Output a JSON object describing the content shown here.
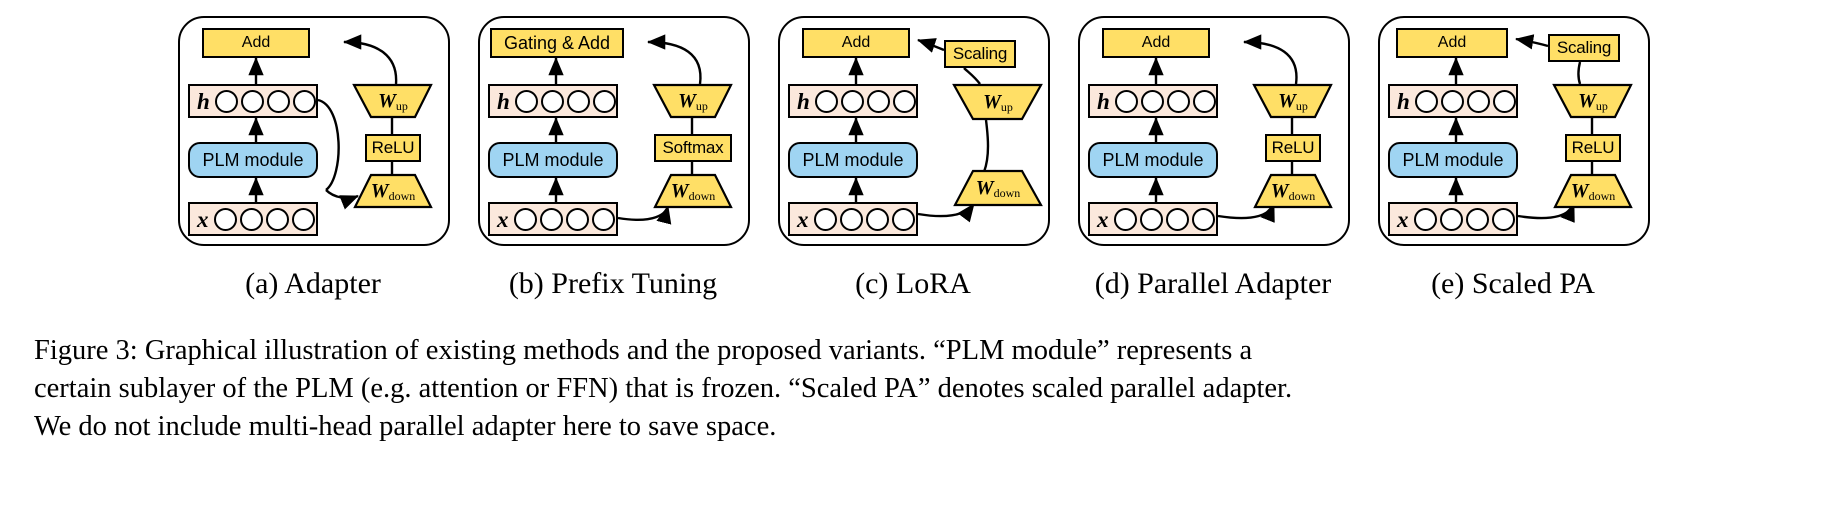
{
  "figure": {
    "number_label": "Figure 3:",
    "caption_line1": "Figure 3:  Graphical illustration of existing methods and the proposed variants.  “PLM module” represents a",
    "caption_line2": "certain sublayer of the PLM (e.g. attention or FFN) that is frozen. “Scaled PA” denotes scaled parallel adapter.",
    "caption_line3": "We do not include multi-head parallel adapter here to save space."
  },
  "colors": {
    "yellow": "#ffdf66",
    "blue": "#9fd4f2",
    "peach": "#fbe8dc",
    "outline": "#000000",
    "background": "#ffffff"
  },
  "common": {
    "plm_module": "PLM module",
    "h_label": "h",
    "x_label": "x",
    "w_up": "W",
    "w_up_sub": "up",
    "w_down": "W",
    "w_down_sub": "down",
    "neuron_count": 4
  },
  "panels": [
    {
      "id": "adapter",
      "caption": "(a) Adapter",
      "top_box": "Add",
      "side_modules": [
        "W_up",
        "ReLU",
        "W_down"
      ],
      "side_labels": {
        "relu": "ReLU",
        "scaling": null
      },
      "input_tap": "x",
      "output_tap": "Add"
    },
    {
      "id": "prefix-tuning",
      "caption": "(b) Prefix Tuning",
      "top_box": "Gating & Add",
      "side_modules": [
        "W_up",
        "Softmax",
        "W_down"
      ],
      "side_labels": {
        "softmax": "Softmax",
        "scaling": null
      },
      "input_tap": "x",
      "output_tap": "Gating & Add"
    },
    {
      "id": "lora",
      "caption": "(c) LoRA",
      "top_box": "Add",
      "side_modules": [
        "Scaling",
        "W_up",
        "W_down"
      ],
      "side_labels": {
        "scaling": "Scaling"
      },
      "input_tap": "x",
      "output_tap": "Add"
    },
    {
      "id": "parallel-adapter",
      "caption": "(d) Parallel Adapter",
      "top_box": "Add",
      "side_modules": [
        "W_up",
        "ReLU",
        "W_down"
      ],
      "side_labels": {
        "relu": "ReLU",
        "scaling": null
      },
      "input_tap": "x",
      "output_tap": "Add"
    },
    {
      "id": "scaled-pa",
      "caption": "(e) Scaled PA",
      "top_box": "Add",
      "side_modules": [
        "Scaling",
        "W_up",
        "ReLU",
        "W_down"
      ],
      "side_labels": {
        "relu": "ReLU",
        "scaling": "Scaling"
      },
      "input_tap": "x",
      "output_tap": "Add"
    }
  ]
}
